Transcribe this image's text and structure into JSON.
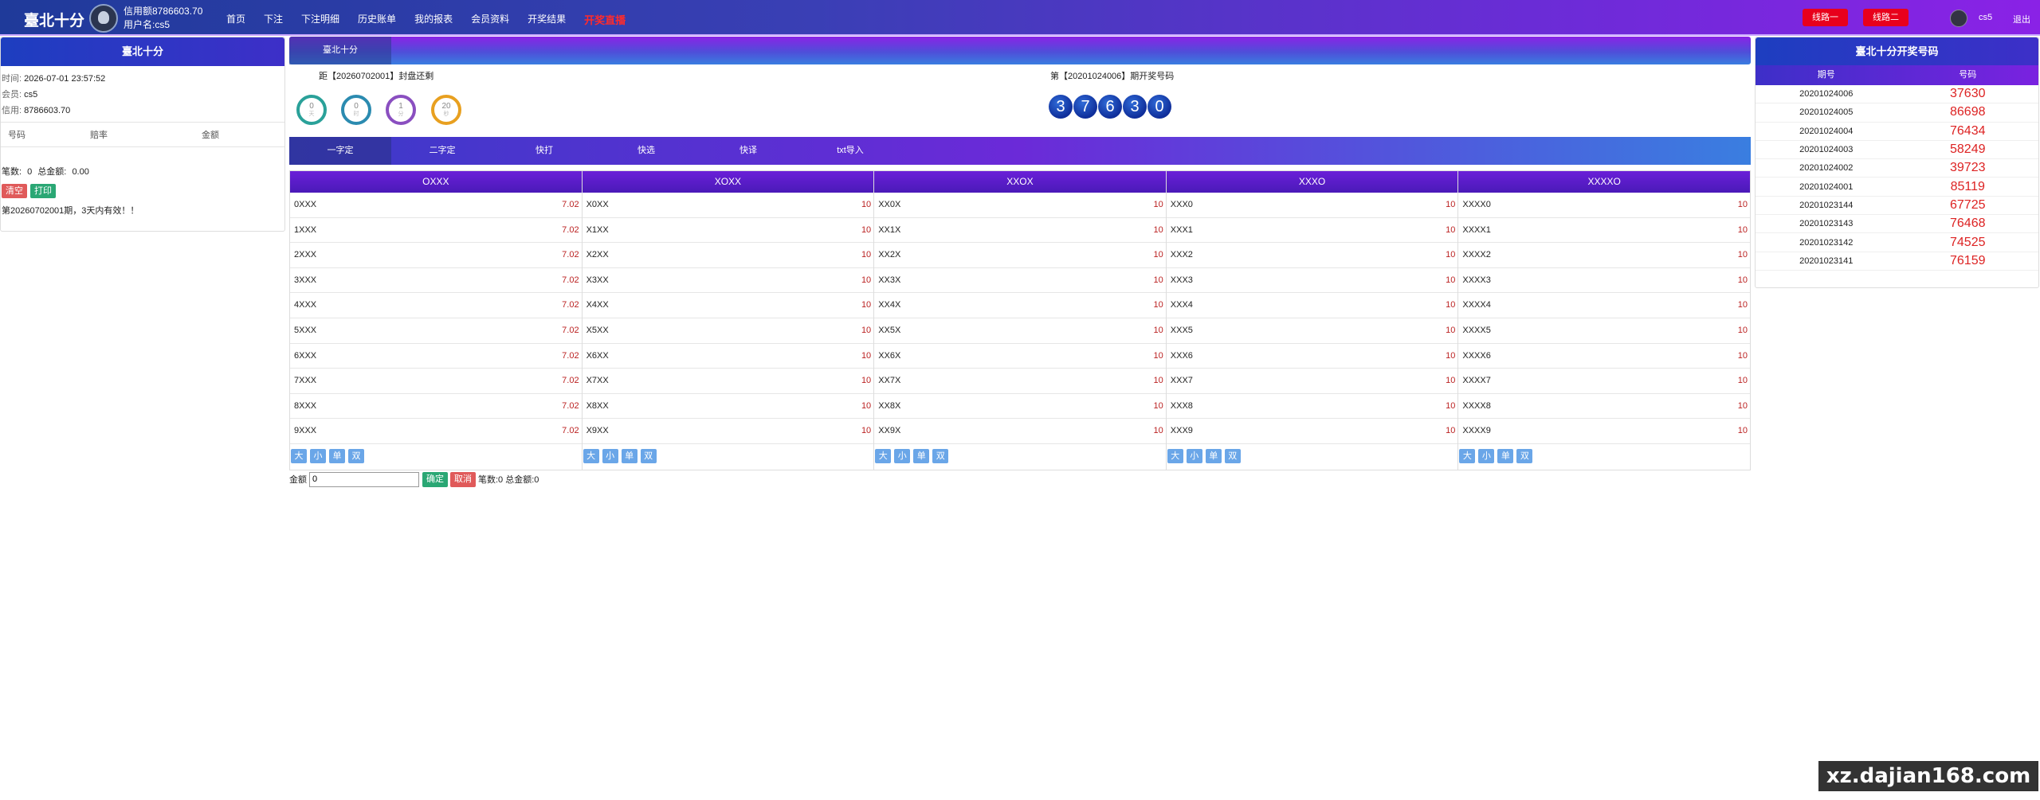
{
  "header": {
    "brand": "臺北十分",
    "credit": "信用额8786603.70",
    "username_line": "用户名:cs5",
    "nav": [
      "首页",
      "下注",
      "下注明细",
      "历史账单",
      "我的报表",
      "会员资料",
      "开奖结果"
    ],
    "nav_hot": "开奖直播",
    "line1": "线路一",
    "line2": "线路二",
    "user": "cs5",
    "logout": "退出"
  },
  "left": {
    "title": "臺北十分",
    "time_label": "时间:",
    "time": "2026-07-01 23:57:52",
    "member_label": "会员:",
    "member": "cs5",
    "credit_label": "信用:",
    "credit": "8786603.70",
    "columns": [
      "号码",
      "赔率",
      "金额"
    ],
    "count_label": "笔数:",
    "count": "0",
    "total_label": "总金额:",
    "total": "0.00",
    "btn_clear": "清空",
    "btn_print": "打印",
    "note": "第20260702001期，3天内有效！！"
  },
  "main": {
    "tab": "臺北十分",
    "close_text": "距【20260702001】封盘还剩",
    "draw_text": "第【20201024006】期开奖号码",
    "countdown": [
      {
        "value": "0",
        "unit": "天",
        "color": "#2aa199"
      },
      {
        "value": "0",
        "unit": "时",
        "color": "#2b8bb0"
      },
      {
        "value": "1",
        "unit": "分",
        "color": "#8a4fc0"
      },
      {
        "value": "20",
        "unit": "秒",
        "color": "#e8a020"
      }
    ],
    "balls": [
      "3",
      "7",
      "6",
      "3",
      "0"
    ],
    "subtabs": [
      "一字定",
      "二字定",
      "快打",
      "快选",
      "快译",
      "txt导入"
    ],
    "active_subtab": 0,
    "columns": [
      {
        "title": "OXXX",
        "rows": [
          [
            "0XXX",
            "7.02"
          ],
          [
            "1XXX",
            "7.02"
          ],
          [
            "2XXX",
            "7.02"
          ],
          [
            "3XXX",
            "7.02"
          ],
          [
            "4XXX",
            "7.02"
          ],
          [
            "5XXX",
            "7.02"
          ],
          [
            "6XXX",
            "7.02"
          ],
          [
            "7XXX",
            "7.02"
          ],
          [
            "8XXX",
            "7.02"
          ],
          [
            "9XXX",
            "7.02"
          ]
        ],
        "btns": [
          "大",
          "小",
          "单",
          "双"
        ]
      },
      {
        "title": "XOXX",
        "rows": [
          [
            "X0XX",
            "10"
          ],
          [
            "X1XX",
            "10"
          ],
          [
            "X2XX",
            "10"
          ],
          [
            "X3XX",
            "10"
          ],
          [
            "X4XX",
            "10"
          ],
          [
            "X5XX",
            "10"
          ],
          [
            "X6XX",
            "10"
          ],
          [
            "X7XX",
            "10"
          ],
          [
            "X8XX",
            "10"
          ],
          [
            "X9XX",
            "10"
          ]
        ],
        "btns": [
          "大",
          "小",
          "单",
          "双"
        ]
      },
      {
        "title": "XXOX",
        "rows": [
          [
            "XX0X",
            "10"
          ],
          [
            "XX1X",
            "10"
          ],
          [
            "XX2X",
            "10"
          ],
          [
            "XX3X",
            "10"
          ],
          [
            "XX4X",
            "10"
          ],
          [
            "XX5X",
            "10"
          ],
          [
            "XX6X",
            "10"
          ],
          [
            "XX7X",
            "10"
          ],
          [
            "XX8X",
            "10"
          ],
          [
            "XX9X",
            "10"
          ]
        ],
        "btns": [
          "大",
          "小",
          "单",
          "双"
        ]
      },
      {
        "title": "XXXO",
        "rows": [
          [
            "XXX0",
            "10"
          ],
          [
            "XXX1",
            "10"
          ],
          [
            "XXX2",
            "10"
          ],
          [
            "XXX3",
            "10"
          ],
          [
            "XXX4",
            "10"
          ],
          [
            "XXX5",
            "10"
          ],
          [
            "XXX6",
            "10"
          ],
          [
            "XXX7",
            "10"
          ],
          [
            "XXX8",
            "10"
          ],
          [
            "XXX9",
            "10"
          ]
        ],
        "btns": [
          "大",
          "小",
          "单",
          "双"
        ]
      },
      {
        "title": "XXXXO",
        "rows": [
          [
            "XXXX0",
            "10"
          ],
          [
            "XXXX1",
            "10"
          ],
          [
            "XXXX2",
            "10"
          ],
          [
            "XXXX3",
            "10"
          ],
          [
            "XXXX4",
            "10"
          ],
          [
            "XXXX5",
            "10"
          ],
          [
            "XXXX6",
            "10"
          ],
          [
            "XXXX7",
            "10"
          ],
          [
            "XXXX8",
            "10"
          ],
          [
            "XXXX9",
            "10"
          ]
        ],
        "btns": [
          "大",
          "小",
          "单",
          "双"
        ]
      }
    ],
    "amount_label": "金额",
    "amount_value": "0",
    "btn_ok": "确定",
    "btn_cancel": "取消",
    "count_text": "笔数:0 总金额:0"
  },
  "right": {
    "title": "臺北十分开奖号码",
    "columns": [
      "期号",
      "号码"
    ],
    "rows": [
      [
        "20201024006",
        "37630"
      ],
      [
        "20201024005",
        "86698"
      ],
      [
        "20201024004",
        "76434"
      ],
      [
        "20201024003",
        "58249"
      ],
      [
        "20201024002",
        "39723"
      ],
      [
        "20201024001",
        "85119"
      ],
      [
        "20201023144",
        "67725"
      ],
      [
        "20201023143",
        "76468"
      ],
      [
        "20201023142",
        "74525"
      ],
      [
        "20201023141",
        "76159"
      ]
    ]
  },
  "watermark": "xz.dajian168.com",
  "colors": {
    "accent": "#3d2fc8",
    "hot": "#e8001c",
    "odds": "#bb2222",
    "btn_green": "#2aa774",
    "btn_red": "#e05a5a",
    "btn_blue": "#6aa6e8"
  }
}
